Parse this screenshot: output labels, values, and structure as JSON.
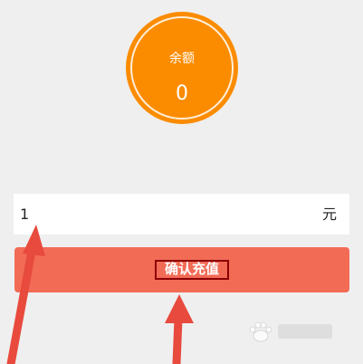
{
  "balance": {
    "label": "余额",
    "value": "0"
  },
  "amount": {
    "value": "1",
    "unit": "元"
  },
  "confirm_button": {
    "label": "确认充值"
  },
  "colors": {
    "balance_circle": "#fb8c00",
    "button": "#f26b55",
    "arrows": "#e84a3e",
    "background": "#efefef"
  }
}
